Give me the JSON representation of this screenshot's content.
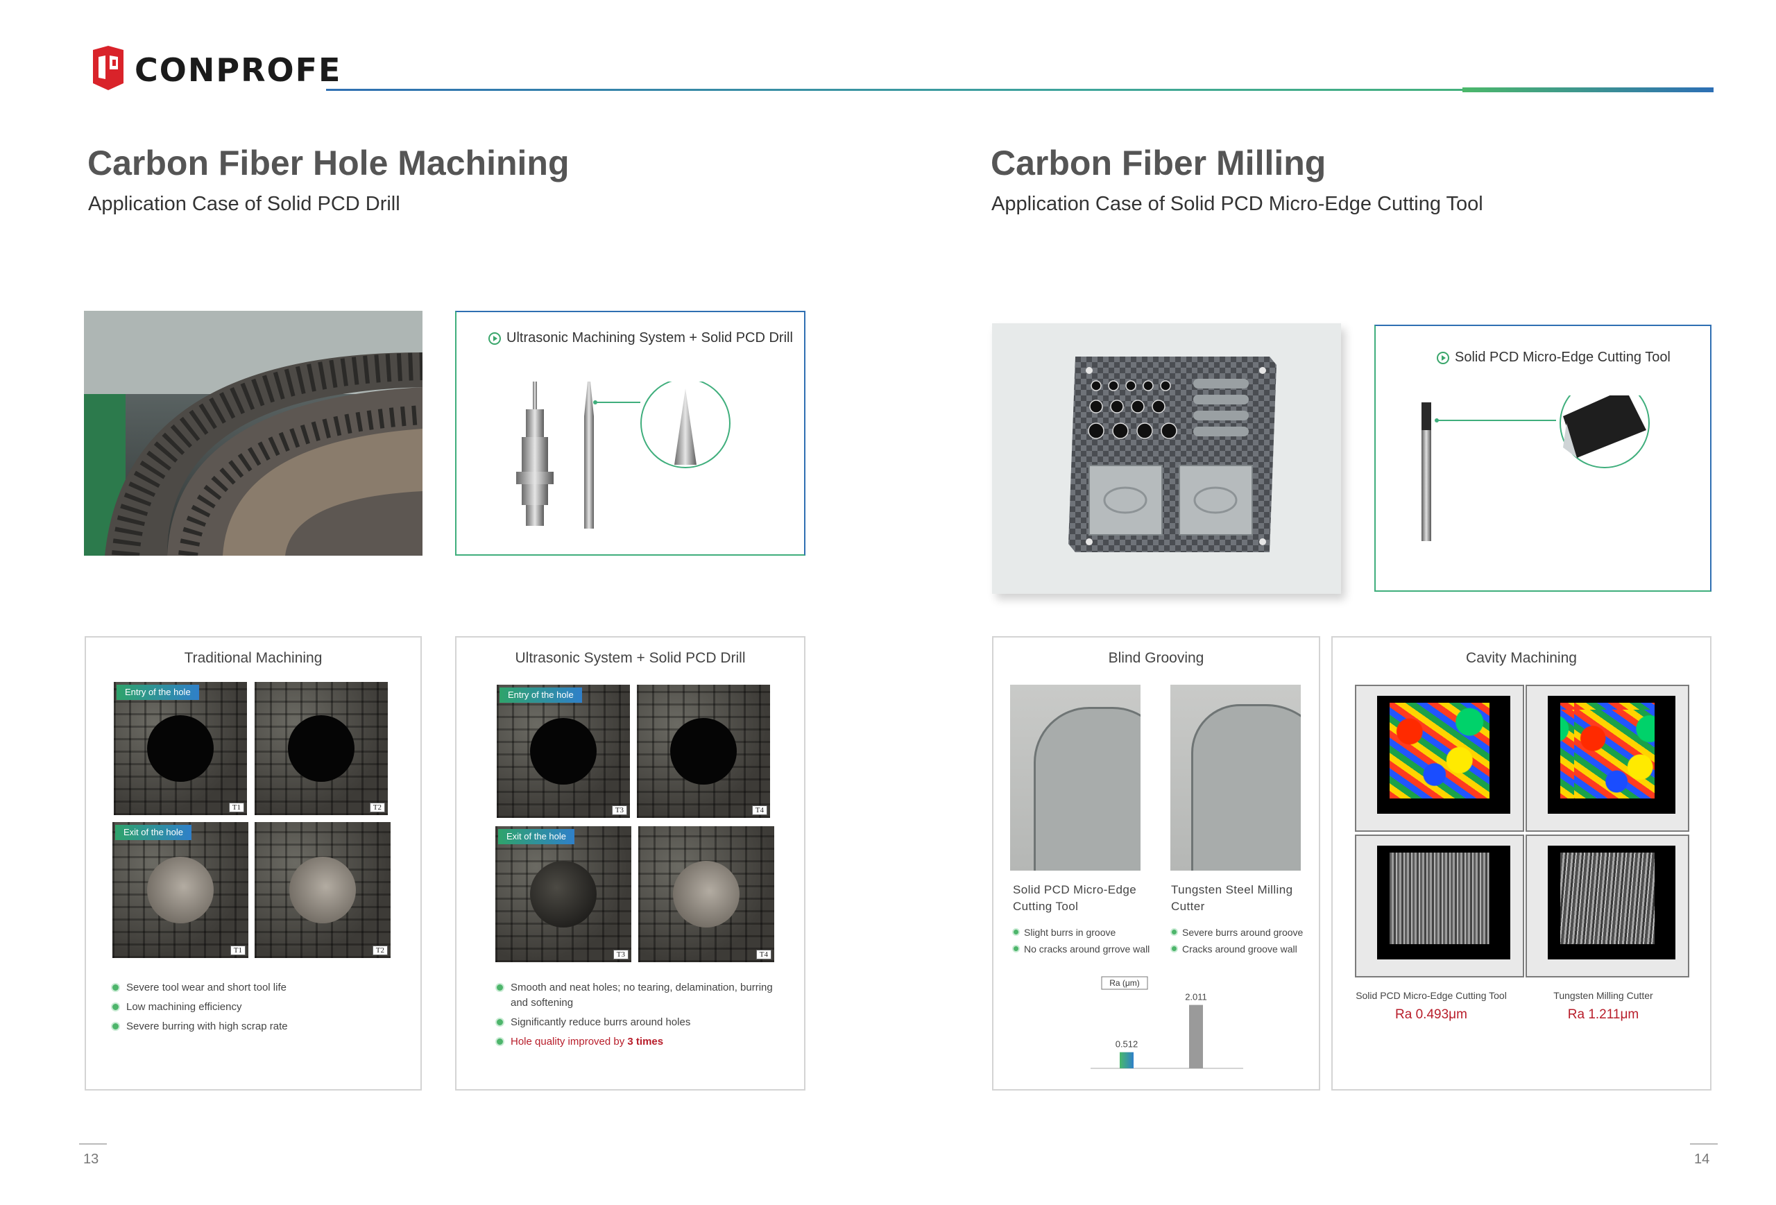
{
  "brand": {
    "name": "CONPROFE",
    "logo_icon": "cp-shield-icon",
    "colors": {
      "red": "#d9232a",
      "green": "#4db56b",
      "blue": "#2f6fb2",
      "accent_red": "#b81d2a"
    }
  },
  "left": {
    "title": "Carbon Fiber Hole Machining",
    "subtitle": "Application Case of Solid PCD Drill",
    "system_caption": "Ultrasonic Machining System + Solid PCD Drill",
    "traditional": {
      "title": "Traditional Machining",
      "entry_tag": "Entry of the hole",
      "exit_tag": "Exit of the hole",
      "tags": [
        "T1",
        "T2",
        "T1",
        "T2"
      ],
      "bullets": [
        "Severe tool wear and short tool life",
        "Low machining efficiency",
        "Severe burring with high scrap rate"
      ]
    },
    "ultrasonic": {
      "title": "Ultrasonic System + Solid PCD Drill",
      "entry_tag": "Entry of the hole",
      "exit_tag": "Exit of the hole",
      "tags": [
        "T3",
        "T4",
        "T3",
        "T4"
      ],
      "bullets": [
        "Smooth and neat holes; no tearing, delamination, burring and softening",
        "Significantly reduce burrs around holes"
      ],
      "highlight_prefix": "Hole quality improved by ",
      "highlight_bold": "3 times"
    },
    "page": "13"
  },
  "right": {
    "title": "Carbon Fiber Milling",
    "subtitle": "Application Case of Solid PCD Micro-Edge Cutting Tool",
    "tool_caption": "Solid PCD Micro-Edge Cutting Tool",
    "blind_grooving": {
      "title": "Blind Grooving",
      "tool_a": "Solid PCD Micro-Edge Cutting Tool",
      "tool_b": "Tungsten Steel Milling Cutter",
      "tool_a_bullets": [
        "Slight burrs in groove",
        "No cracks around grrove wall"
      ],
      "tool_b_bullets": [
        "Severe burrs around groove",
        "Cracks around groove wall"
      ],
      "ra_axis_label": "Ra (μm)"
    },
    "cavity": {
      "title": "Cavity Machining",
      "tool_a": "Solid PCD Micro-Edge Cutting Tool",
      "tool_b": "Tungsten Milling Cutter",
      "ra_a": "Ra 0.493μm",
      "ra_b": "Ra 1.211μm"
    },
    "page": "14"
  },
  "chart_data": {
    "type": "bar",
    "categories": [
      "Solid PCD Micro-Edge Cutting Tool",
      "Tungsten Steel Milling Cutter"
    ],
    "values": [
      0.512,
      2.011
    ],
    "value_labels": [
      "0.512",
      "2.011"
    ],
    "ylabel": "Ra (μm)",
    "colors": [
      "#3aa66b",
      "#9a9a9a"
    ]
  }
}
